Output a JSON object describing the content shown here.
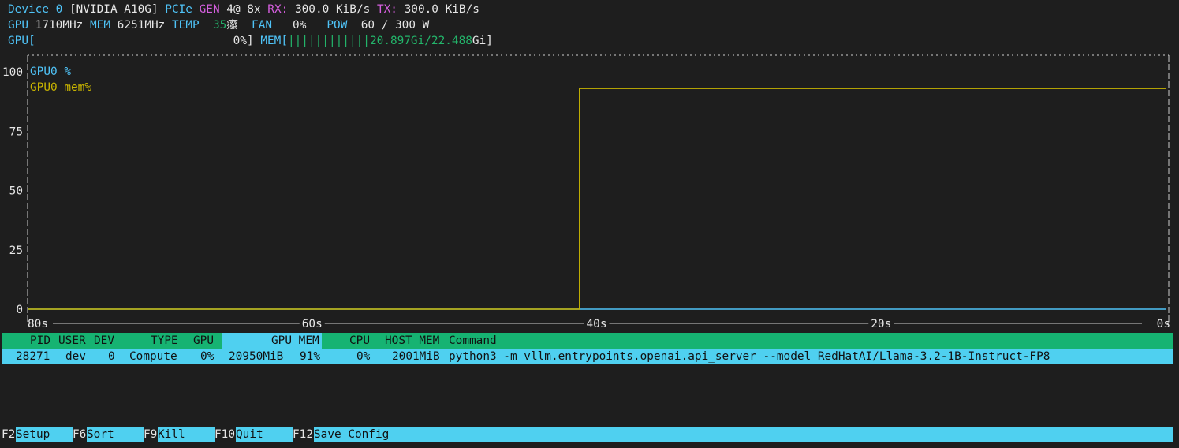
{
  "device": {
    "label": "Device 0",
    "name": "[NVIDIA A10G]",
    "pcie_label": "PCIe",
    "gen_label": "GEN",
    "gen_value": "4@ 8x",
    "rx_label": "RX:",
    "rx_value": "300.0 KiB/s",
    "tx_label": "TX:",
    "tx_value": "300.0 KiB/s"
  },
  "stats": {
    "gpu_label": "GPU",
    "gpu_clock": "1710MHz",
    "mem_label": "MEM",
    "mem_clock": "6251MHz",
    "temp_label": "TEMP",
    "temp_value": "35",
    "temp_unit": "癈",
    "fan_label": "FAN",
    "fan_value": "0%",
    "pow_label": "POW",
    "pow_value": "60 / 300 W"
  },
  "bars": {
    "gpu_label": "GPU[",
    "gpu_value": "0%]",
    "mem_label": "MEM[",
    "mem_bar": "||||||||||||",
    "mem_used": "20.897Gi/22.488",
    "mem_unit": "Gi]"
  },
  "chart_data": {
    "type": "line",
    "title": "",
    "xlabel": "",
    "ylabel": "",
    "y_ticks": [
      "100",
      "75",
      "50",
      "25",
      "0"
    ],
    "x_ticks": [
      "80s",
      "60s",
      "40s",
      "20s",
      "0s"
    ],
    "ylim": [
      0,
      100
    ],
    "xlim": [
      -80,
      0
    ],
    "series": [
      {
        "name": "GPU0 %",
        "color": "#4fc3f7",
        "x": [
          -80,
          0
        ],
        "y": [
          0,
          0
        ]
      },
      {
        "name": "GPU0 mem%",
        "color": "#c8b400",
        "x": [
          -80,
          -41.2,
          -41.2,
          0
        ],
        "y": [
          0,
          0,
          93,
          93
        ]
      }
    ]
  },
  "process_table": {
    "columns": [
      "PID",
      "USER",
      "DEV",
      "TYPE",
      "GPU",
      "GPU MEM",
      "CPU",
      "HOST MEM",
      "Command"
    ],
    "rows": [
      {
        "pid": "28271",
        "user": "dev",
        "dev": "0",
        "type": "Compute",
        "gpu": "0%",
        "gpu_mem": "20950MiB",
        "gpu_mem_pct": "91%",
        "cpu": "0%",
        "host_mem": "2001MiB",
        "command": "python3 -m vllm.entrypoints.openai.api_server --model RedHatAI/Llama-3.2-1B-Instruct-FP8"
      }
    ]
  },
  "footer": [
    {
      "key": "F2",
      "label": "Setup"
    },
    {
      "key": "F6",
      "label": "Sort"
    },
    {
      "key": "F9",
      "label": "Kill"
    },
    {
      "key": "F10",
      "label": "Quit"
    },
    {
      "key": "F12",
      "label": "Save Config"
    }
  ]
}
